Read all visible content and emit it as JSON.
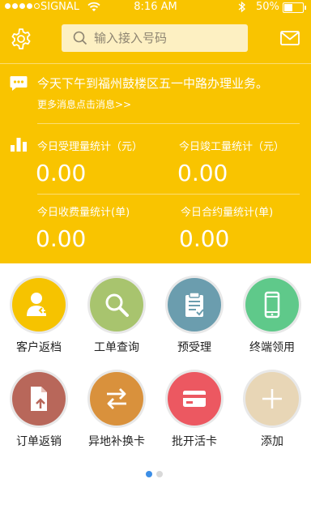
{
  "status_bar": {
    "carrier": "SIGNAL",
    "time": "8:16 AM",
    "battery": "50%",
    "battery_level": 0.5
  },
  "header": {
    "search_placeholder": "输入接入号码"
  },
  "message": {
    "text": "今天下午到福州鼓楼区五一中路办理业务。",
    "more_link": "更多消息点击消息>>"
  },
  "stats": [
    {
      "label": "今日受理量统计（元）",
      "value": "0.00"
    },
    {
      "label": "今日竣工量统计（元）",
      "value": "0.00"
    },
    {
      "label": "今日收费量统计(单)",
      "value": "0.00"
    },
    {
      "label": "今日合约量统计(单)",
      "value": "0.00"
    }
  ],
  "grid": [
    {
      "label": "客户返档",
      "icon": "customer-return-icon",
      "color": "#f6c300"
    },
    {
      "label": "工单查询",
      "icon": "magnifier-icon",
      "color": "#a8c46e"
    },
    {
      "label": "预受理",
      "icon": "clipboard-icon",
      "color": "#6b9dae"
    },
    {
      "label": "终端领用",
      "icon": "phone-icon",
      "color": "#5fc98a"
    },
    {
      "label": "订单返销",
      "icon": "document-upload-icon",
      "color": "#b8675a"
    },
    {
      "label": "异地补换卡",
      "icon": "swap-arrows-icon",
      "color": "#d9913c"
    },
    {
      "label": "批开活卡",
      "icon": "card-icon",
      "color": "#ec5861"
    },
    {
      "label": "添加",
      "icon": "plus-icon",
      "color": "#e8d6b6"
    }
  ],
  "pager": {
    "pages": 2,
    "current": 1
  },
  "colors": {
    "brand_yellow": "#f9c400",
    "pager_active": "#3c8ee6"
  }
}
